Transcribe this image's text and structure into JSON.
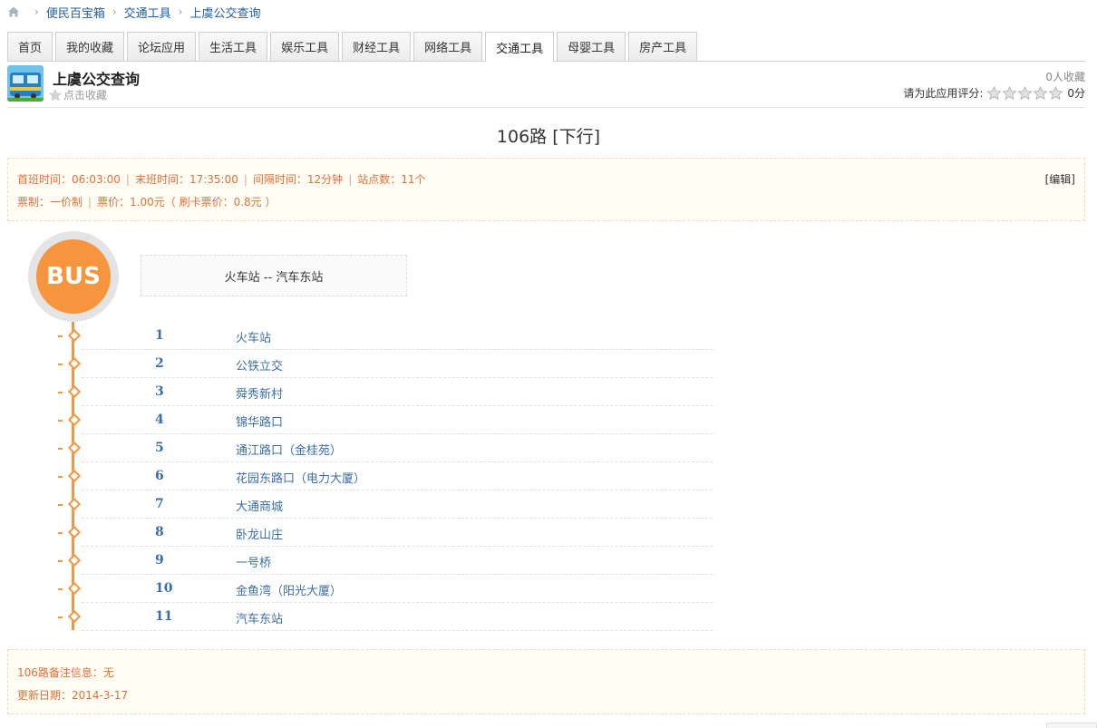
{
  "breadcrumb": {
    "items": [
      "便民百宝箱",
      "交通工具",
      "上虞公交查询"
    ]
  },
  "tabs": [
    "首页",
    "我的收藏",
    "论坛应用",
    "生活工具",
    "娱乐工具",
    "财经工具",
    "网络工具",
    "交通工具",
    "母婴工具",
    "房产工具"
  ],
  "active_tab": "交通工具",
  "app": {
    "title": "上虞公交查询",
    "fav_link": "点击收藏",
    "fav_count": "0人收藏",
    "rating_label": "请为此应用评分:",
    "score": "0分",
    "stars": 0
  },
  "route": {
    "title": "106路  [下行]",
    "info1": [
      "首班时间：06:03:00",
      "末班时间：17:35:00",
      "间隔时间：12分钟",
      "站点数：11个"
    ],
    "info2": [
      "票制：一价制",
      "票价：1.00元（ 刷卡票价：0.8元 ）"
    ],
    "edit": "[编辑]",
    "badge": "BUS",
    "direction": "火车站 -- 汽车东站",
    "stations": [
      {
        "num": "1",
        "name": "火车站"
      },
      {
        "num": "2",
        "name": "公铁立交"
      },
      {
        "num": "3",
        "name": "舜秀新村"
      },
      {
        "num": "4",
        "name": "锦华路口"
      },
      {
        "num": "5",
        "name": "通江路口（金桂苑）"
      },
      {
        "num": "6",
        "name": "花园东路口（电力大厦）"
      },
      {
        "num": "7",
        "name": "大通商城"
      },
      {
        "num": "8",
        "name": "卧龙山庄"
      },
      {
        "num": "9",
        "name": "一号桥"
      },
      {
        "num": "10",
        "name": "金鱼湾（阳光大厦）"
      },
      {
        "num": "11",
        "name": "汽车东站"
      }
    ],
    "note": "106路备注信息：无",
    "update": "更新日期：2014-3-17"
  },
  "colors": {
    "accent": "#f7953e",
    "link": "#1a5fa8",
    "info_text": "#e0703a"
  }
}
